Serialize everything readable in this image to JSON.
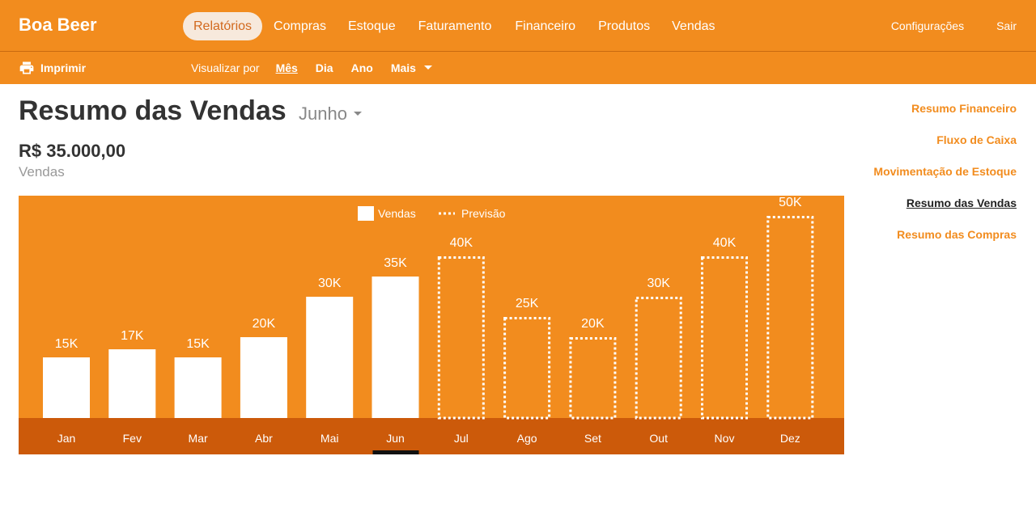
{
  "app": {
    "title": "Boa Beer"
  },
  "nav": {
    "items": [
      {
        "label": "Relatórios",
        "active": true
      },
      {
        "label": "Compras"
      },
      {
        "label": "Estoque"
      },
      {
        "label": "Faturamento"
      },
      {
        "label": "Financeiro"
      },
      {
        "label": "Produtos"
      },
      {
        "label": "Vendas"
      }
    ],
    "settings_label": "Configurações",
    "logout_label": "Sair"
  },
  "toolbar": {
    "print_label": "Imprimir",
    "view_by_label": "Visualizar por",
    "options": [
      "Mês",
      "Dia",
      "Ano",
      "Mais"
    ],
    "selected_option": "Mês"
  },
  "page": {
    "title": "Resumo das Vendas",
    "month_selected": "Junho",
    "amount": "R$ 35.000,00",
    "amount_label": "Vendas"
  },
  "side_links": [
    {
      "label": "Resumo Financeiro"
    },
    {
      "label": "Fluxo de Caixa"
    },
    {
      "label": "Movimentação de Estoque"
    },
    {
      "label": "Resumo das Vendas",
      "selected": true
    },
    {
      "label": "Resumo das Compras"
    }
  ],
  "colors": {
    "accent": "#f28c1e",
    "axis_band": "#cc5a0a",
    "selected_marker": "#111111"
  },
  "chart_data": {
    "type": "bar",
    "categories": [
      "Jan",
      "Fev",
      "Mar",
      "Abr",
      "Mai",
      "Jun",
      "Jul",
      "Ago",
      "Set",
      "Out",
      "Nov",
      "Dez"
    ],
    "series": [
      {
        "name": "Vendas",
        "values": [
          15,
          17,
          15,
          20,
          30,
          35,
          null,
          null,
          null,
          null,
          null,
          null
        ]
      },
      {
        "name": "Previsão",
        "values": [
          null,
          null,
          null,
          null,
          null,
          null,
          40,
          25,
          20,
          30,
          40,
          50
        ]
      }
    ],
    "data_labels": [
      "15K",
      "17K",
      "15K",
      "20K",
      "30K",
      "35K",
      "40K",
      "25K",
      "20K",
      "30K",
      "40K",
      "50K"
    ],
    "selected_category": "Jun",
    "ylim": [
      0,
      100
    ],
    "legend": "top-center",
    "grid": false
  }
}
